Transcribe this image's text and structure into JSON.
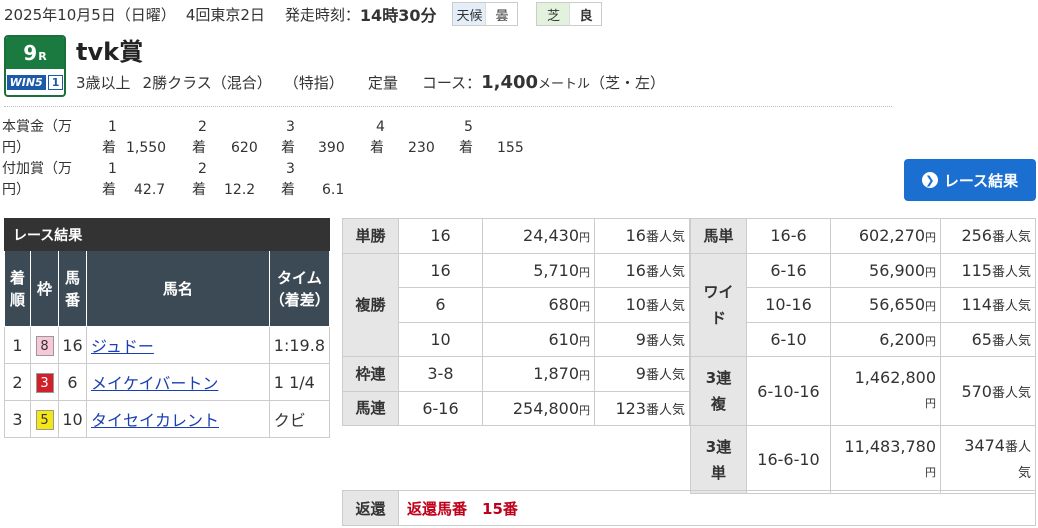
{
  "header": {
    "date": "2025年10月5日（日曜）",
    "meeting": "4回東京2日",
    "post_time_label": "発走時刻：",
    "post_time": "14時30分",
    "weather_label": "天候",
    "weather": "曇",
    "track_label": "芝",
    "track_condition": "良"
  },
  "race": {
    "number": "9",
    "number_suffix": "R",
    "win5_label": "WIN5",
    "win5_leg": "1",
    "name": "tvk賞",
    "age": "3歳以上",
    "class": "2勝クラス（混合）",
    "special": "（特指）",
    "weight": "定量",
    "course_label": "コース：",
    "distance": "1,400",
    "distance_unit": "メートル",
    "surface": "（芝・左）"
  },
  "prize": {
    "label_line1": "本賞金（万",
    "label_line2": "円）",
    "places": [
      "1",
      "2",
      "3",
      "4",
      "5"
    ],
    "place_suffix": "着",
    "amounts": [
      "1,550",
      "620",
      "390",
      "230",
      "155"
    ]
  },
  "added_prize": {
    "label_line1": "付加賞（万",
    "label_line2": "円）",
    "places": [
      "1",
      "2",
      "3"
    ],
    "place_suffix": "着",
    "amounts": [
      "42.7",
      "12.2",
      "6.1"
    ]
  },
  "result_button": {
    "label": "レース結果",
    "icon": "chevron-right-circle-icon"
  },
  "results": {
    "caption": "レース結果",
    "headers": {
      "rank": "着順",
      "waku": "枠",
      "horse_no": "馬番",
      "name": "馬名",
      "time": "タイム（着差）"
    },
    "rows": [
      {
        "rank": "1",
        "waku": "8",
        "waku_bg": "#f8c8d8",
        "waku_fg": "#333333",
        "horse_no": "16",
        "name": "ジュドー",
        "time": "1:19.8"
      },
      {
        "rank": "2",
        "waku": "3",
        "waku_bg": "#d0202a",
        "waku_fg": "#ffffff",
        "horse_no": "6",
        "name": "メイケイバートン",
        "time": "1 1/4"
      },
      {
        "rank": "3",
        "waku": "5",
        "waku_bg": "#f5e619",
        "waku_fg": "#333333",
        "horse_no": "10",
        "name": "タイセイカレント",
        "time": "クビ"
      }
    ]
  },
  "payouts_left": {
    "yen_unit": "円",
    "rank_unit": "番人気",
    "tansho": {
      "label": "単勝",
      "rows": [
        {
          "combo": "16",
          "payout": "24,430",
          "popularity": "16"
        }
      ]
    },
    "fukusho": {
      "label": "複勝",
      "rows": [
        {
          "combo": "16",
          "payout": "5,710",
          "popularity": "16"
        },
        {
          "combo": "6",
          "payout": "680",
          "popularity": "10"
        },
        {
          "combo": "10",
          "payout": "610",
          "popularity": "9"
        }
      ]
    },
    "wakuren": {
      "label": "枠連",
      "rows": [
        {
          "combo": "3-8",
          "payout": "1,870",
          "popularity": "9"
        }
      ]
    },
    "umaren": {
      "label": "馬連",
      "rows": [
        {
          "combo": "6-16",
          "payout": "254,800",
          "popularity": "123"
        }
      ]
    }
  },
  "payouts_right": {
    "umatan": {
      "label": "馬単",
      "rows": [
        {
          "combo": "16-6",
          "payout": "602,270",
          "popularity": "256"
        }
      ]
    },
    "wide": {
      "label_line1": "ワイ",
      "label_line2": "ド",
      "rows": [
        {
          "combo": "6-16",
          "payout": "56,900",
          "popularity": "115"
        },
        {
          "combo": "10-16",
          "payout": "56,650",
          "popularity": "114"
        },
        {
          "combo": "6-10",
          "payout": "6,200",
          "popularity": "65"
        }
      ]
    },
    "sanrenpuku": {
      "label_line1": "3連",
      "label_line2": "複",
      "rows": [
        {
          "combo": "6-10-16",
          "payout": "1,462,800",
          "popularity": "570"
        }
      ]
    },
    "sanrentan": {
      "label_line1": "3連",
      "label_line2": "単",
      "rows": [
        {
          "combo": "16-6-10",
          "payout": "11,483,780",
          "popularity": "3474"
        }
      ]
    }
  },
  "refund": {
    "label": "返還",
    "text": "返還馬番　15番"
  }
}
